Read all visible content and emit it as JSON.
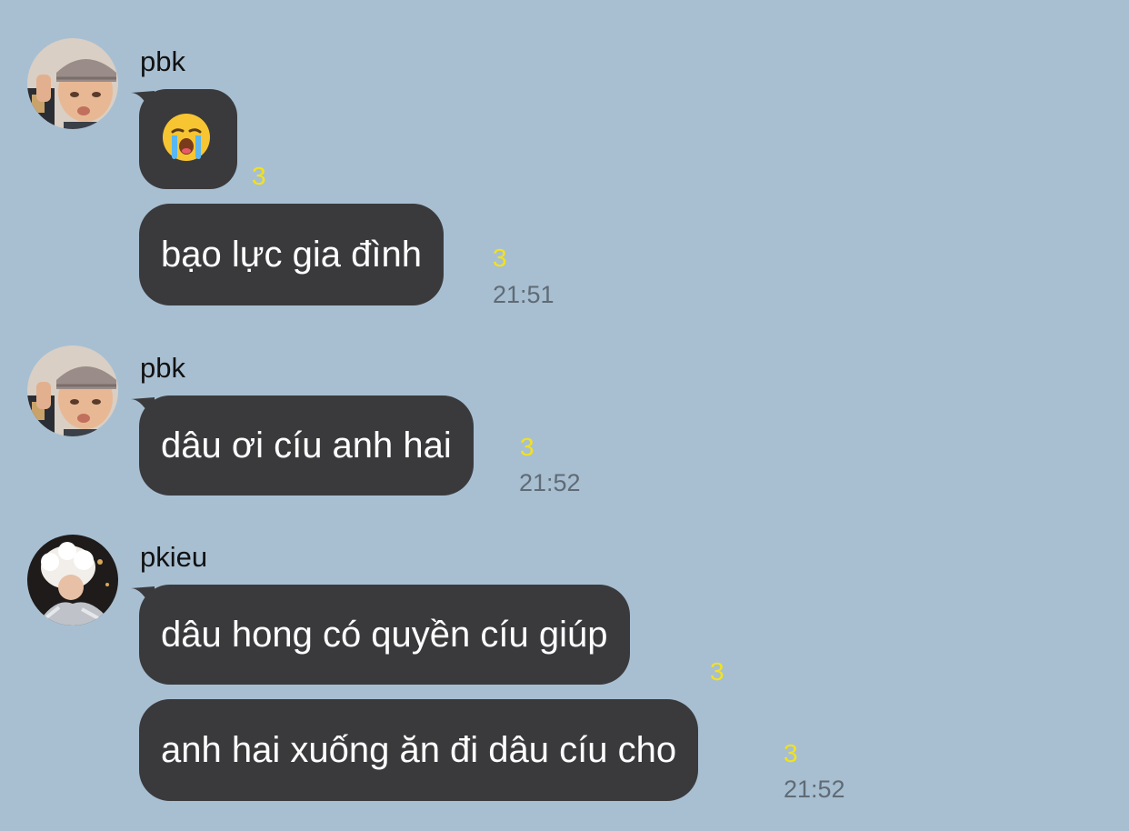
{
  "messages": [
    {
      "sender": "pbk",
      "avatar": "avatar-pbk",
      "bubbles": [
        {
          "text": "",
          "emoji": "loudly-crying-face-emoji",
          "unread": "3",
          "time": ""
        },
        {
          "text": "bạo lực gia đình",
          "unread": "3",
          "time": "21:51"
        }
      ]
    },
    {
      "sender": "pbk",
      "avatar": "avatar-pbk",
      "bubbles": [
        {
          "text": "dâu ơi cíu anh hai",
          "unread": "3",
          "time": "21:52"
        }
      ]
    },
    {
      "sender": "pkieu",
      "avatar": "avatar-pkieu",
      "bubbles": [
        {
          "text": "dâu hong có quyền cíu giúp",
          "unread": "3",
          "time": ""
        },
        {
          "text": "anh hai xuống ăn đi dâu cíu cho",
          "unread": "3",
          "time": "21:52"
        }
      ]
    }
  ],
  "colors": {
    "background": "#a8bfd2",
    "bubble": "#3a3a3d",
    "unread": "#f3e21b",
    "time": "#5f6b75"
  }
}
